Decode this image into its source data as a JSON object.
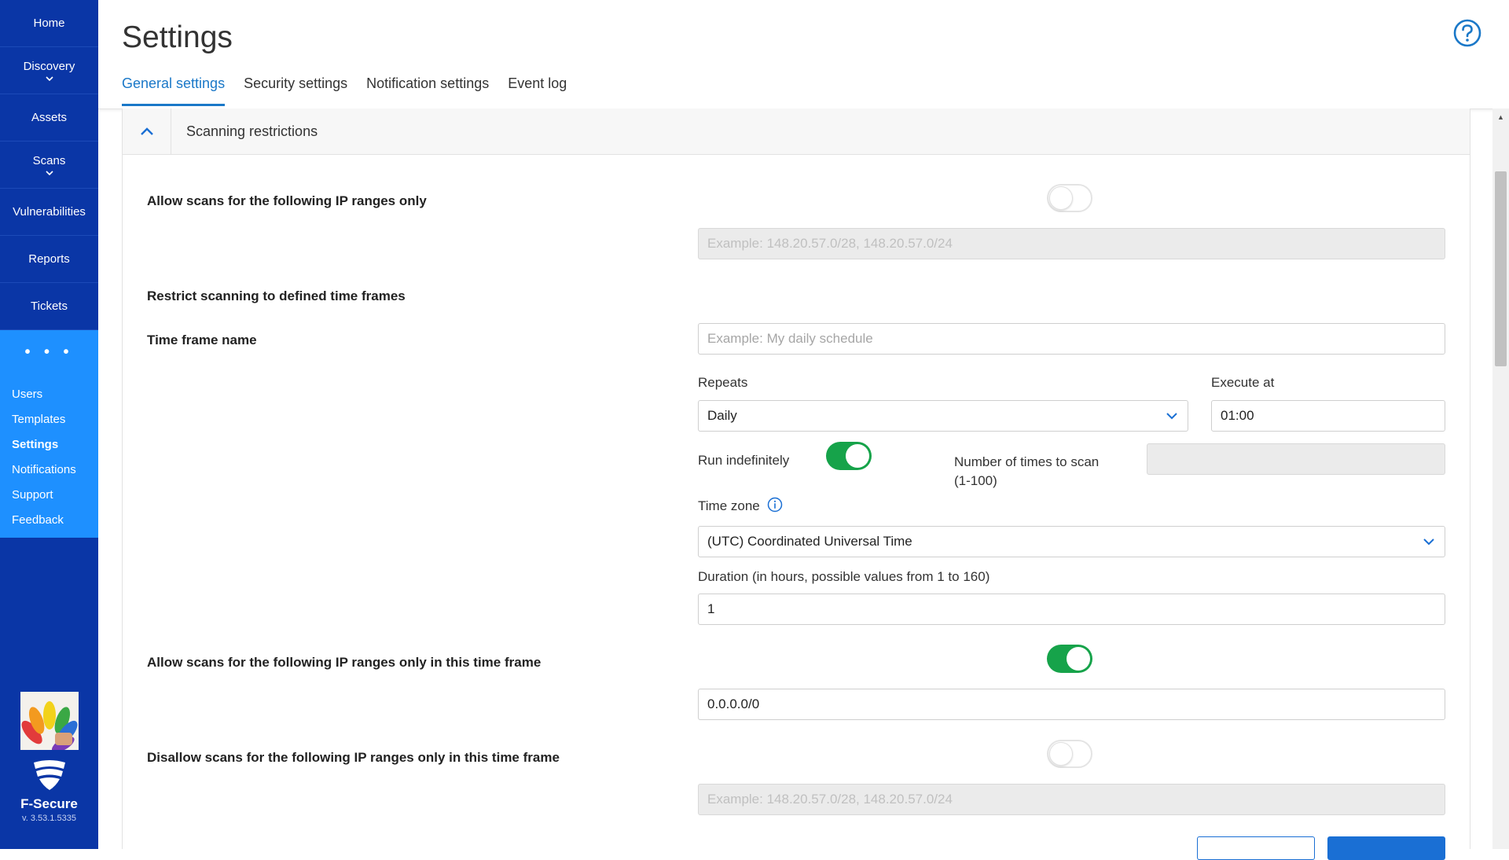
{
  "sidebar": {
    "items": [
      {
        "label": "Home"
      },
      {
        "label": "Discovery"
      },
      {
        "label": "Assets"
      },
      {
        "label": "Scans"
      },
      {
        "label": "Vulnerabilities"
      },
      {
        "label": "Reports"
      },
      {
        "label": "Tickets"
      }
    ],
    "more_label": "• • •",
    "submenu": [
      "Users",
      "Templates",
      "Settings",
      "Notifications",
      "Support",
      "Feedback"
    ],
    "active_submenu": "Settings",
    "brand": "F-Secure",
    "version": "v. 3.53.1.5335"
  },
  "header": {
    "title": "Settings",
    "tabs": [
      "General settings",
      "Security settings",
      "Notification settings",
      "Event log"
    ],
    "active_tab": "General settings"
  },
  "section": {
    "title": "Scanning restrictions"
  },
  "form": {
    "allow_ip_label": "Allow scans for the following IP ranges only",
    "allow_ip_enabled": false,
    "allow_ip_placeholder": "Example: 148.20.57.0/28, 148.20.57.0/24",
    "restrict_time_label": "Restrict scanning to defined time frames",
    "time_frame_name_label": "Time frame name",
    "time_frame_name_placeholder": "Example: My daily schedule",
    "repeats_label": "Repeats",
    "repeats_value": "Daily",
    "execute_at_label": "Execute at",
    "execute_at_value": "01:00",
    "run_indefinitely_label": "Run indefinitely",
    "run_indefinitely_enabled": true,
    "times_to_scan_label_line1": "Number of times to scan",
    "times_to_scan_label_line2": "(1-100)",
    "time_zone_label": "Time zone",
    "time_zone_value": "(UTC) Coordinated Universal Time",
    "duration_label": "Duration (in hours, possible values from 1 to 160)",
    "duration_value": "1",
    "allow_ip_tf_label": "Allow scans for the following IP ranges only in this time frame",
    "allow_ip_tf_enabled": true,
    "allow_ip_tf_value": "0.0.0.0/0",
    "disallow_ip_tf_label": "Disallow scans for the following IP ranges only in this time frame",
    "disallow_ip_tf_enabled": false,
    "disallow_ip_tf_placeholder": "Example: 148.20.57.0/28, 148.20.57.0/24"
  },
  "colors": {
    "sidebar": "#0a36a6",
    "sidebar_active": "#1e90ff",
    "accent": "#1a78c8",
    "toggle_on": "#16a34a"
  }
}
